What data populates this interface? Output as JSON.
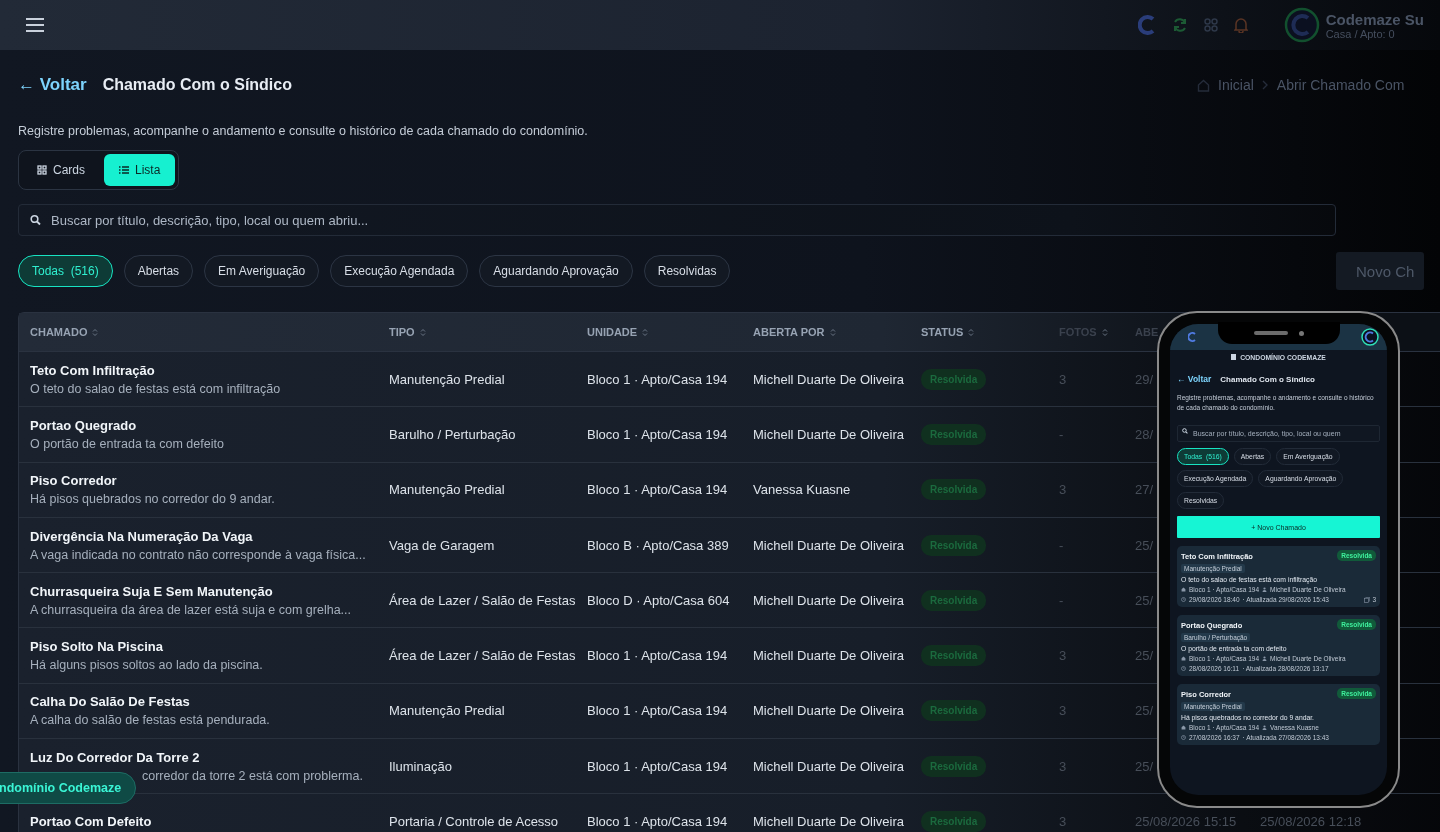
{
  "topbar": {
    "user_name": "Codemaze Su",
    "user_unit": "Casa / Apto: 0"
  },
  "header": {
    "back": "← Voltar",
    "title": "Chamado Com o Síndico",
    "breadcrumb": [
      "Inicial",
      "Abrir Chamado Com"
    ]
  },
  "description": "Registre problemas, acompanhe o andamento e consulte o histórico de cada chamado do condomínio.",
  "view_toggle": [
    {
      "label": "Cards",
      "kind": "grid",
      "selected": false
    },
    {
      "label": "Lista",
      "kind": "list",
      "selected": true
    }
  ],
  "search": {
    "placeholder": "Buscar por título, descrição, tipo, local ou quem abriu..."
  },
  "filters": [
    {
      "label": "Todas",
      "count": "(516)",
      "selected": true
    },
    {
      "label": "Abertas",
      "selected": false
    },
    {
      "label": "Em Averiguação",
      "selected": false
    },
    {
      "label": "Execução Agendada",
      "selected": false
    },
    {
      "label": "Aguardando Aprovação",
      "selected": false
    },
    {
      "label": "Resolvidas",
      "selected": false
    }
  ],
  "new_button": "Novo Ch",
  "table": {
    "columns": [
      "CHAMADO",
      "TIPO",
      "UNIDADE",
      "ABERTA POR",
      "STATUS",
      "FOTOS",
      "ABE"
    ],
    "rows": [
      {
        "title": "Teto Com Infiltração",
        "description": "O teto do salao de festas está com infiltração",
        "type": "Manutenção Predial",
        "unit": "Bloco 1 · Apto/Casa 194",
        "opened_by": "Michell Duarte De Oliveira",
        "status": "Resolvida",
        "photos": "3",
        "opened": "29/"
      },
      {
        "title": "Portao Quegrado",
        "description": "O portão de entrada ta com defeito",
        "type": "Barulho / Perturbação",
        "unit": "Bloco 1 · Apto/Casa 194",
        "opened_by": "Michell Duarte De Oliveira",
        "status": "Resolvida",
        "photos": "-",
        "opened": "28/"
      },
      {
        "title": "Piso Corredor",
        "description": "Há pisos quebrados no corredor do 9 andar.",
        "type": "Manutenção Predial",
        "unit": "Bloco 1 · Apto/Casa 194",
        "opened_by": "Vanessa Kuasne",
        "status": "Resolvida",
        "photos": "3",
        "opened": "27/"
      },
      {
        "title": "Divergência Na Numeração Da Vaga",
        "description": "A vaga indicada no contrato não corresponde à vaga física...",
        "type": "Vaga de Garagem",
        "unit": "Bloco B · Apto/Casa 389",
        "opened_by": "Michell Duarte De Oliveira",
        "status": "Resolvida",
        "photos": "-",
        "opened": "25/"
      },
      {
        "title": "Churrasqueira Suja E Sem Manutenção",
        "description": "A churrasqueira da área de lazer está suja e com grelha...",
        "type": "Área de Lazer / Salão de Festas",
        "unit": "Bloco D · Apto/Casa 604",
        "opened_by": "Michell Duarte De Oliveira",
        "status": "Resolvida",
        "photos": "-",
        "opened": "25/"
      },
      {
        "title": "Piso Solto Na Piscina",
        "description": "Há alguns pisos soltos ao lado da piscina.",
        "type": "Área de Lazer / Salão de Festas",
        "unit": "Bloco 1 · Apto/Casa 194",
        "opened_by": "Michell Duarte De Oliveira",
        "status": "Resolvida",
        "photos": "3",
        "opened": "25/"
      },
      {
        "title": "Calha Do Salão De Festas",
        "description": "A calha do salão de festas está pendurada.",
        "type": "Manutenção Predial",
        "unit": "Bloco 1 · Apto/Casa 194",
        "opened_by": "Michell Duarte De Oliveira",
        "status": "Resolvida",
        "photos": "3",
        "opened": "25/"
      },
      {
        "title": "Luz Do Corredor Da Torre 2",
        "description": "corredor da torre 2 está com problerma.",
        "obscured": true,
        "type": "Iluminação",
        "unit": "Bloco 1 · Apto/Casa 194",
        "opened_by": "Michell Duarte De Oliveira",
        "status": "Resolvida",
        "photos": "3",
        "opened": "25/"
      },
      {
        "title": "Portao Com Defeito",
        "type": "Portaria / Controle de Acesso",
        "unit": "Bloco 1 · Apto/Casa 194",
        "opened_by": "Michell Duarte De Oliveira",
        "status": "Resolvida",
        "photos": "3",
        "opened": "25/08/2026 15:15",
        "updated": "25/08/2026 12:18"
      }
    ]
  },
  "floating_badge": "ndomínio Codemaze",
  "phone": {
    "brand": "CONDOMÍNIO CODEMAZE",
    "back": "← Voltar",
    "title": "Chamado Com o Síndico",
    "description": "Registre problemas, acompanhe o andamento e consulte o histórico de cada chamado do condomínio.",
    "search_placeholder": "Buscar por título, descrição, tipo, local ou quem",
    "filters": [
      {
        "label": "Todas",
        "count": "(516)",
        "selected": true
      },
      {
        "label": "Abertas",
        "selected": false
      },
      {
        "label": "Em Averiguação",
        "selected": false
      },
      {
        "label": "Execução Agendada",
        "selected": false
      },
      {
        "label": "Aguardando Aprovação",
        "selected": false
      },
      {
        "label": "Resolvidas",
        "selected": false
      }
    ],
    "new_button": "+ Novo Chamado",
    "cards": [
      {
        "title": "Teto Com Infiltração",
        "status": "Resolvida",
        "type": "Manutenção Predial",
        "description": "O teto do salao de festas está com infiltração",
        "unit": "Bloco 1 · Apto/Casa 194",
        "opened_by": "Michell Duarte De Oliveira",
        "opened": "29/08/2026 18:40",
        "updated": "· Atualizada 29/08/2026 15:43",
        "photos": "3"
      },
      {
        "title": "Portao Quegrado",
        "status": "Resolvida",
        "type": "Barulho / Perturbação",
        "description": "O portão de entrada ta com defeito",
        "unit": "Bloco 1 · Apto/Casa 194",
        "opened_by": "Michell Duarte De Oliveira",
        "opened": "28/08/2026 16:11",
        "updated": "· Atualizada 28/08/2026 13:17"
      },
      {
        "title": "Piso Corredor",
        "status": "Resolvida",
        "type": "Manutenção Predial",
        "description": "Há pisos quebrados no corredor do 9 andar.",
        "unit": "Bloco 1 · Apto/Casa 194",
        "opened_by": "Vanessa Kuasne",
        "opened": "27/08/2026 16:37",
        "updated": "· Atualizada 27/08/2026 13:43"
      }
    ]
  }
}
